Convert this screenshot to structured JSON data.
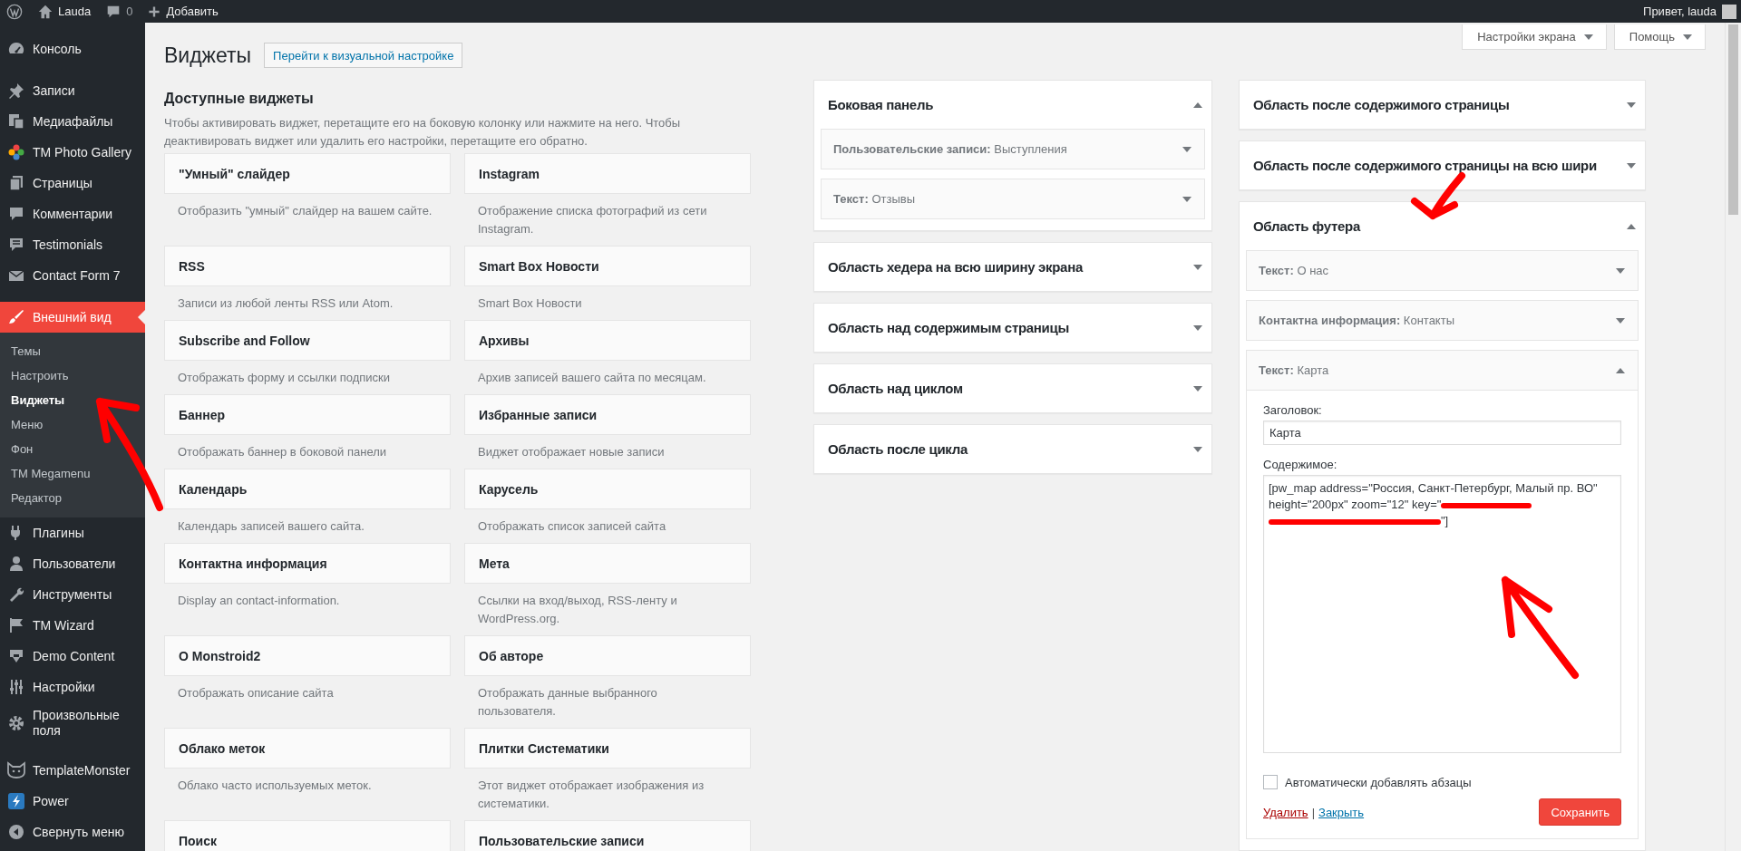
{
  "admin_bar": {
    "site_name": "Lauda",
    "comments_count": "0",
    "new_label": "Добавить",
    "greeting": "Привет, lauda"
  },
  "menu_groups": [
    {
      "items": [
        {
          "label": "Консоль",
          "selected": false
        }
      ]
    },
    {
      "items": [
        {
          "label": "Записи",
          "selected": false
        },
        {
          "label": "Медиафайлы",
          "selected": false
        },
        {
          "label": "TM Photo Gallery",
          "selected": false
        },
        {
          "label": "Страницы",
          "selected": false
        },
        {
          "label": "Комментарии",
          "selected": false
        },
        {
          "label": "Testimonials",
          "selected": false
        },
        {
          "label": "Contact Form 7",
          "selected": false
        }
      ]
    },
    {
      "items": [
        {
          "label": "Внешний вид",
          "selected": true,
          "children": [
            {
              "label": "Темы",
              "selected": false
            },
            {
              "label": "Настроить",
              "selected": false
            },
            {
              "label": "Виджеты",
              "selected": true
            },
            {
              "label": "Меню",
              "selected": false
            },
            {
              "label": "Фон",
              "selected": false
            },
            {
              "label": "TM Megamenu",
              "selected": false
            },
            {
              "label": "Редактор",
              "selected": false
            }
          ]
        },
        {
          "label": "Плагины",
          "selected": false
        },
        {
          "label": "Пользователи",
          "selected": false
        },
        {
          "label": "Инструменты",
          "selected": false
        },
        {
          "label": "TM Wizard",
          "selected": false
        },
        {
          "label": "Demo Content",
          "selected": false
        },
        {
          "label": "Настройки",
          "selected": false
        },
        {
          "label": "Произвольные поля",
          "selected": false
        }
      ]
    },
    {
      "items": [
        {
          "label": "TemplateMonster",
          "selected": false
        },
        {
          "label": "Power",
          "selected": false
        },
        {
          "label": "Свернуть меню",
          "selected": false
        }
      ]
    }
  ],
  "page": {
    "title": "Виджеты",
    "customize_button": "Перейти к визуальной настройке"
  },
  "screen_tabs": [
    {
      "label": "Настройки экрана"
    },
    {
      "label": "Помощь"
    }
  ],
  "available_widgets": {
    "title": "Доступные виджеты",
    "description": "Чтобы активировать виджет, перетащите его на боковую колонку или нажмите на него. Чтобы деактивировать виджет или удалить его настройки, перетащите его обратно.",
    "widgets": [
      {
        "title": "\"Умный\" слайдер",
        "description": "Отобразить \"умный\" слайдер на вашем сайте."
      },
      {
        "title": "Instagram",
        "description": "Отображение списка фотографий из сети Instagram."
      },
      {
        "title": "RSS",
        "description": "Записи из любой ленты RSS или Atom."
      },
      {
        "title": "Smart Box Новости",
        "description": "Smart Box Новости"
      },
      {
        "title": "Subscribe and Follow",
        "description": "Отображать форму и ссылки подписки"
      },
      {
        "title": "Архивы",
        "description": "Архив записей вашего сайта по месяцам."
      },
      {
        "title": "Баннер",
        "description": "Отображать баннер в боковой панели"
      },
      {
        "title": "Избранные записи",
        "description": "Виджет отображает новые записи"
      },
      {
        "title": "Календарь",
        "description": "Календарь записей вашего сайта."
      },
      {
        "title": "Карусель",
        "description": "Отображать список записей сайта"
      },
      {
        "title": "Контактна информация",
        "description": "Display an contact-information."
      },
      {
        "title": "Мета",
        "description": "Ссылки на вход/выход, RSS-ленту и WordPress.org."
      },
      {
        "title": "О Monstroid2",
        "description": "Отображать описание сайта"
      },
      {
        "title": "Об авторе",
        "description": "Отображать данные выбранного пользователя."
      },
      {
        "title": "Облако меток",
        "description": "Облако часто используемых меток."
      },
      {
        "title": "Плитки Систематики",
        "description": "Этот виджет отображает изображения из систематики."
      },
      {
        "title": "Поиск"
      },
      {
        "title": "Пользовательские записи"
      }
    ]
  },
  "widget_area_columns": [
    {
      "areas": [
        {
          "title": "Боковая панель",
          "expanded": true,
          "widgets": [
            {
              "label": "**Пользовательские записи:** Выступления",
              "expanded": false
            },
            {
              "label": "**Текст:** Отзывы",
              "expanded": false
            }
          ]
        },
        {
          "title": "Область хедера на всю ширину экрана",
          "expanded": false
        },
        {
          "title": "Область над содержимым страницы",
          "expanded": false
        },
        {
          "title": "Область над циклом",
          "expanded": false
        },
        {
          "title": "Область после цикла",
          "expanded": false
        }
      ]
    },
    {
      "areas": [
        {
          "title": "Область после содержимого страницы",
          "expanded": false
        },
        {
          "title": "Область после содержимого страницы на всю шири",
          "expanded": false
        },
        {
          "title": "Область футера",
          "expanded": true,
          "widgets": [
            {
              "label": "**Текст:** О нас",
              "expanded": false
            },
            {
              "label": "**Контактна информация:** Контакты",
              "expanded": false
            },
            {
              "label": "**Текст:** Карта",
              "expanded": true,
              "form": {
                "title_label": "Заголовок:",
                "title_value": "Карта",
                "content_label": "Содержимое:",
                "content_before": "[pw_map address=\"Россия, Санкт-Петербург, Малый пр. ВО\" height=\"200px\" zoom=\"12\" key=\"",
                "key_redacted": true,
                "content_after": "\"]",
                "auto_paragraphs_label": "Автоматически добавлять абзацы",
                "auto_paragraphs_checked": false,
                "delete_link": "Удалить",
                "separator": "|",
                "close_link": "Закрыть",
                "save_button": "Сохранить"
              }
            }
          ]
        }
      ]
    }
  ],
  "annotations": [
    {
      "kind": "arrow"
    },
    {
      "kind": "arrow"
    },
    {
      "kind": "arrow"
    }
  ]
}
